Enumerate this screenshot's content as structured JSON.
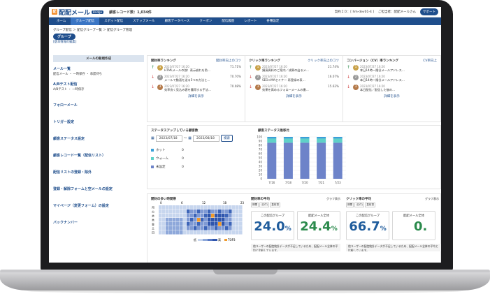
{
  "app": {
    "logo_mark": "配",
    "logo_text": "配配メール",
    "logo_badge": "Bridge",
    "registered": "顧客レコード数：1,034件"
  },
  "top": {
    "contract": "契約ＩＤ：[ hm-dev01-4 ]",
    "user": "ご担当者：配配メールさん",
    "support": "サポート"
  },
  "nav": [
    "ホーム",
    "グループ配信",
    "スポット配信",
    "ステップメール",
    "顧客データベース",
    "クーポン",
    "配信履歴",
    "レポート",
    "各種設定"
  ],
  "crumbs": "グループ配信 ＞ 配信グループ一覧 ＞ 配信グループ管理",
  "group_badge": "グループ",
  "group_sub": "[基本情報の編集]",
  "side": {
    "head": "メールの新規作成",
    "items": [
      {
        "label": "メール一覧",
        "sub": "配信メール ・ 一時保存 ・ 承認待ち"
      },
      {
        "label": "A/Bテスト配信",
        "sub": "A/Bテスト ・ 一時保存"
      },
      {
        "label": "フォローメール",
        "sub": ""
      },
      {
        "label": "トリガー設定",
        "sub": ""
      },
      {
        "label": "顧客ステータス設定",
        "sub": ""
      },
      {
        "label": "顧客レコード一覧（配信リスト）",
        "sub": ""
      },
      {
        "label": "配信リストの登録・除外",
        "sub": ""
      },
      {
        "label": "登録・解除フォームと空メールの設定",
        "sub": ""
      },
      {
        "label": "マイページ（変更フォーム）の設定",
        "sub": ""
      },
      {
        "label": "バックナンバー",
        "sub": ""
      }
    ]
  },
  "rankings": [
    {
      "title": "開封率ランキング",
      "link": "開封率向上のコツ",
      "rows": [
        {
          "arrow": "↑",
          "rank": "1",
          "date": "2023/07/27 16:20",
          "text": "HTMLメールの独！表示崩れを防…",
          "pct": "71.71%"
        },
        {
          "arrow": "↓",
          "rank": "2",
          "date": "2023/07/27 16:20",
          "text": "メールで動画を送る5つの方法と…",
          "pct": "70.70%"
        },
        {
          "arrow": "↓",
          "rank": "3",
          "date": "2023/07/27 16:20",
          "text": "効率良く見込み客を獲得する手法…",
          "pct": "70.08%"
        }
      ],
      "more": "詳細を表示"
    },
    {
      "title": "クリック率ランキング",
      "link": "クリック率向上のコツ",
      "rows": [
        {
          "arrow": "↑",
          "rank": "1",
          "date": "2023/07/27 16:20",
          "text": "講演資料のご案内／成果の出るメ…",
          "pct": "21.74%"
        },
        {
          "arrow": "↓",
          "rank": "2",
          "date": "2023/07/27 16:20",
          "text": "SEO×MAセミナー 再登録の表…",
          "pct": "16.07%"
        },
        {
          "arrow": "↓",
          "rank": "3",
          "date": "2023/07/27 16:20",
          "text": "効果を高めるフォローメールの書…",
          "pct": "15.62%"
        }
      ],
      "more": "詳細を表示"
    },
    {
      "title": "コンバージョン（CV）率ランキング",
      "link": "CV率向上",
      "rows": [
        {
          "arrow": "↑",
          "rank": "1",
          "date": "2023/07/27 16:20",
          "text": "本日14時〜隆谷メールアドレス…",
          "pct": ""
        },
        {
          "arrow": "↓",
          "rank": "2",
          "date": "2023/07/27 16:20",
          "text": "本日14時〜隆谷メールアドレス…",
          "pct": ""
        },
        {
          "arrow": "↓",
          "rank": "3",
          "date": "2023/07/27 16:20",
          "text": "本日配信／配信した後の…",
          "pct": ""
        }
      ],
      "more": "詳細を表示"
    }
  ],
  "status": {
    "title": "ステータスアップしている顧客数",
    "date_from": "2023/07/18",
    "tilde": "～",
    "date_to": "2023/08/18",
    "search": "検索",
    "legend": [
      {
        "label": "ホット",
        "value": "0",
        "color": "#3aa0d8"
      },
      {
        "label": "ウォーム",
        "value": "0",
        "color": "#5fd1c8"
      },
      {
        "label": "未設定",
        "value": "0",
        "color": "#6d83c9"
      }
    ]
  },
  "chart_title": "顧客ステータス推移比",
  "chart_data": {
    "type": "bar",
    "categories": [
      "7/16",
      "7/18",
      "7/20",
      "7/21",
      "7/23"
    ],
    "series": [
      {
        "values": [
          86,
          86,
          86,
          86,
          86
        ],
        "color": "#6d83c9"
      },
      {
        "values": [
          10,
          10,
          10,
          10,
          10
        ],
        "color": "#5fd1c8"
      },
      {
        "values": [
          4,
          4,
          4,
          4,
          4
        ],
        "color": "#3aa0d8"
      }
    ],
    "ylim": [
      0,
      100
    ],
    "yticks": [
      "100",
      "90",
      "80",
      "70",
      "60",
      "50",
      "40",
      "30",
      "20",
      "10",
      "0"
    ]
  },
  "heat": {
    "title": "開封の多い時間帯",
    "hours": [
      "0",
      "6",
      "12",
      "18",
      "23"
    ],
    "days": [
      "月",
      "火",
      "水",
      "木",
      "金",
      "土",
      "日"
    ],
    "legend_low": "低",
    "legend_high": "高",
    "legend_top": "TOP3"
  },
  "open_avg": {
    "title": "開封率の平均",
    "tag": "グラフ表示",
    "chips": [
      "期間",
      "(日付)",
      "直前週"
    ],
    "a_label": "この配信グループ",
    "a_value": "24.0",
    "b_label": "配配メール全体",
    "b_value": "24.4",
    "unit": "%",
    "note": "他ユーザーの配信統計データが不足しているため、配配メール全体の平均と比較しています。"
  },
  "click_avg": {
    "title": "クリック率の平均",
    "tag": "グラフ表示",
    "chips": [
      "期間",
      "(日付)",
      "直前週"
    ],
    "a_label": "この配信グループ",
    "a_value": "66.7",
    "b_label": "配配メール全体",
    "b_value": "0.",
    "unit": "%",
    "note": "他ユーザーの配信統計データが不足しているため、配配メール全体の平均と比較しています。"
  }
}
